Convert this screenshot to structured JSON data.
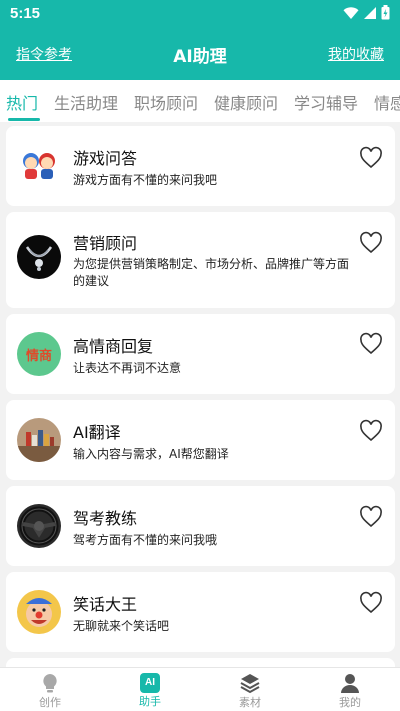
{
  "status": {
    "time": "5:15"
  },
  "appbar": {
    "left_link": "指令参考",
    "title": "AI助理",
    "right_link": "我的收藏"
  },
  "tabs": [
    "热门",
    "生活助理",
    "职场顾问",
    "健康顾问",
    "学习辅导",
    "情感"
  ],
  "cards": [
    {
      "name": "游戏问答",
      "desc": "游戏方面有不懂的来问我吧",
      "icon": "cartoon-kids-icon"
    },
    {
      "name": "营销顾问",
      "desc": "为您提供营销策略制定、市场分析、品牌推广等方面的建议",
      "icon": "necklace-icon"
    },
    {
      "name": "高情商回复",
      "desc": "让表达不再词不达意",
      "icon": "eq-icon",
      "badge": "情商"
    },
    {
      "name": "AI翻译",
      "desc": "输入内容与需求，AI帮您翻译",
      "icon": "books-icon"
    },
    {
      "name": "驾考教练",
      "desc": "驾考方面有不懂的来问我哦",
      "icon": "steering-wheel-icon"
    },
    {
      "name": "笑话大王",
      "desc": "无聊就来个笑话吧",
      "icon": "clown-icon"
    }
  ],
  "bottom_nav": [
    {
      "label": "创作",
      "icon": "bulb-icon"
    },
    {
      "label": "助手",
      "icon": "ai-icon",
      "badge": "AI",
      "active": true
    },
    {
      "label": "素材",
      "icon": "layers-icon"
    },
    {
      "label": "我的",
      "icon": "person-icon"
    }
  ],
  "colors": {
    "accent": "#17b8aa",
    "background": "#f2f2f2"
  }
}
